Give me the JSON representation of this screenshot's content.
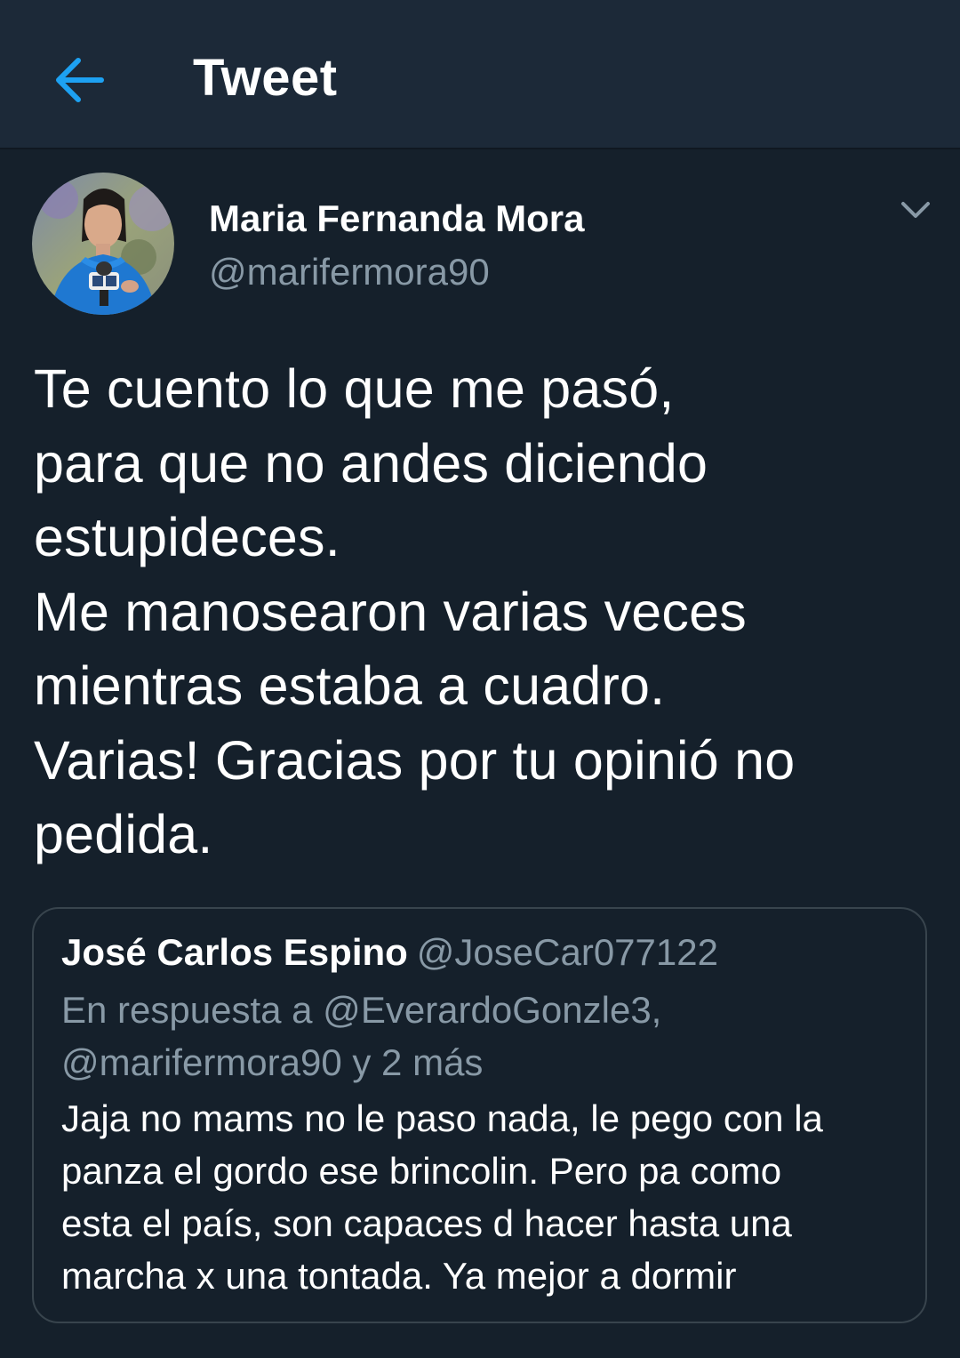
{
  "header": {
    "back_icon": "arrow-left-icon",
    "title": "Tweet",
    "accent_color": "#1da1f2"
  },
  "tweet": {
    "avatar_icon": "profile-photo",
    "author_name": "Maria Fernanda Mora",
    "author_handle": "@marifermora90",
    "more_icon": "chevron-down-icon",
    "text": "Te cuento lo que me pasó,\npara que no andes diciendo\nestupideces.\nMe manosearon varias veces\nmientras estaba a cuadro.\nVarias! Gracias por tu opinió no\npedida."
  },
  "quoted_tweet": {
    "author_name": "José Carlos Espino",
    "author_handle": "@JoseCar077122",
    "reply_context": "En respuesta a @EverardoGonzle3,\n@marifermora90 y 2 más",
    "text": "Jaja no mams no le paso nada, le pego con la\npanza el gordo ese brincolin. Pero pa como\nesta el país, son capaces d hacer hasta una\nmarcha x una tontada. Ya mejor a dormir"
  },
  "colors": {
    "background": "#15202b",
    "header_background": "#1c2938",
    "secondary_text": "#8899a6",
    "border": "#38444d"
  }
}
